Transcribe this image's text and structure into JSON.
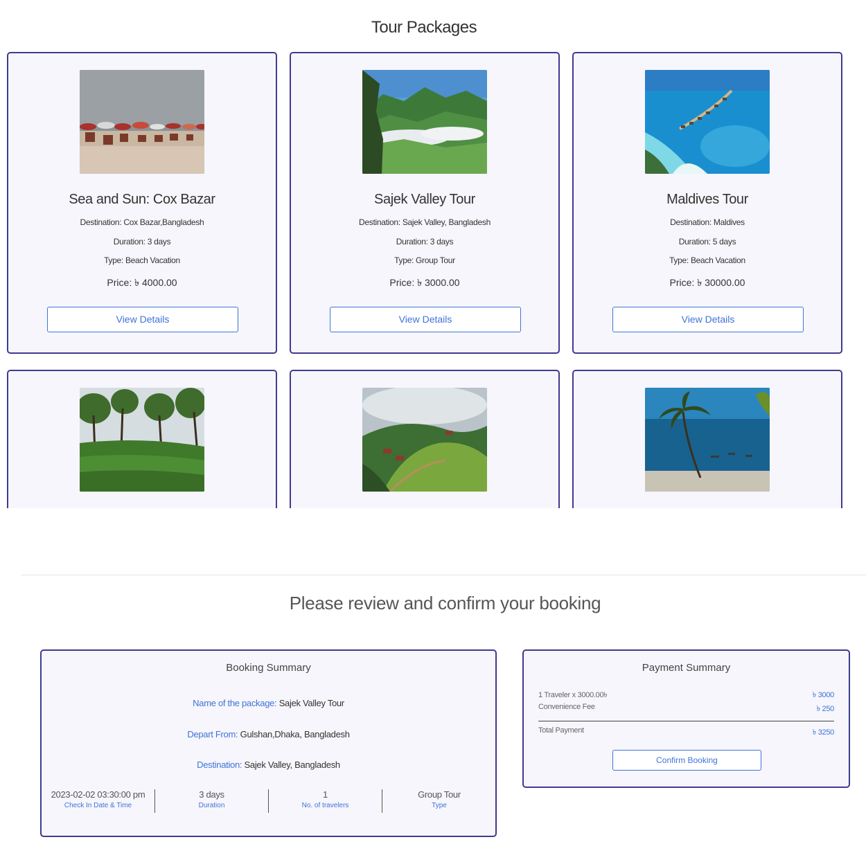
{
  "tour_packages": {
    "heading": "Tour Packages",
    "packages": [
      {
        "title": "Sea and Sun: Cox Bazar",
        "destination": "Destination: Cox Bazar,Bangladesh",
        "duration": "Duration: 3 days",
        "type": "Type: Beach Vacation",
        "price": "Price: ৳ 4000.00",
        "button": "View Details"
      },
      {
        "title": "Sajek Valley Tour",
        "destination": "Destination: Sajek Valley, Bangladesh",
        "duration": "Duration: 3 days",
        "type": "Type: Group Tour",
        "price": "Price: ৳ 3000.00",
        "button": "View Details"
      },
      {
        "title": "Maldives Tour",
        "destination": "Destination: Maldives",
        "duration": "Duration: 5 days",
        "type": "Type: Beach Vacation",
        "price": "Price: ৳ 30000.00",
        "button": "View Details"
      },
      {
        "image": "tea-garden-photo"
      },
      {
        "image": "hill-village-photo"
      },
      {
        "image": "palm-beach-photo"
      }
    ]
  },
  "review": {
    "heading": "Please review and confirm your booking"
  },
  "booking_summary": {
    "title": "Booking Summary",
    "package_label": "Name of the package:",
    "package_value": "Sajek Valley Tour",
    "depart_label": "Depart From:",
    "depart_value": "Gulshan,Dhaka, Bangladesh",
    "destination_label": "Destination:",
    "destination_value": "Sajek Valley, Bangladesh",
    "stats": [
      {
        "value": "2023-02-02 03:30:00 pm",
        "label": "Check In Date & Time"
      },
      {
        "value": "3 days",
        "label": "Duration"
      },
      {
        "value": "1",
        "label": "No. of travelers"
      },
      {
        "value": "Group Tour",
        "label": "Type"
      }
    ]
  },
  "payment_summary": {
    "title": "Payment Summary",
    "rows": [
      {
        "label": "1 Traveler x 3000.00৳",
        "amount": "৳ 3000"
      },
      {
        "label": "Convenience Fee",
        "amount": "৳ 250"
      }
    ],
    "total_label": "Total Payment",
    "total_amount": "৳ 3250",
    "confirm_label": "Confirm Booking"
  },
  "colors": {
    "card_border": "#3f3a8f",
    "card_bg": "#f6f6fc",
    "accent": "#3f73d8"
  }
}
